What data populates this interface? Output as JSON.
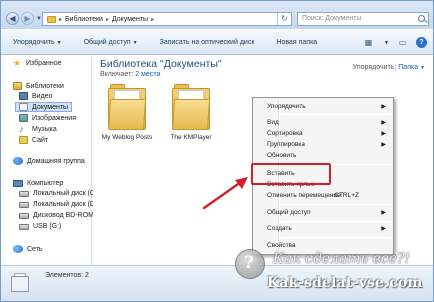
{
  "address": {
    "crumbs": [
      "Библиотеки",
      "Документы"
    ],
    "search_placeholder": "Поиск: Документы"
  },
  "toolbar": {
    "organize": "Упорядочить",
    "share": "Общий доступ",
    "burn": "Записать на оптический диск",
    "new_folder": "Новая папка"
  },
  "sidebar": {
    "favorites": "Избранное",
    "libraries": "Библиотеки",
    "video": "Видео",
    "documents": "Документы",
    "images": "Изображения",
    "music": "Музыка",
    "site": "Сайт",
    "homegroup": "Домашняя группа",
    "computer": "Компьютер",
    "disk_c": "Локальный диск (C",
    "disk_d": "Локальный диск (D",
    "bd_rom": "Дисковод BD-ROM",
    "usb": "USB (G:)",
    "network": "Сеть"
  },
  "content": {
    "title": "Библиотека \"Документы\"",
    "subtitle_prefix": "Включает:",
    "subtitle_link": "2 места",
    "arrange_label": "Упорядочить:",
    "arrange_value": "Папка",
    "folders": [
      "My Weblog Posts",
      "The KMPlayer"
    ]
  },
  "context_menu": {
    "items": [
      "Упорядочить",
      "Вид",
      "Сортировка",
      "Группировка",
      "Обновить",
      "Вставить",
      "Вставить ярлык",
      "Отменить перемещение",
      "Общий доступ",
      "Создать",
      "Свойства"
    ],
    "undo_shortcut": "CTRL+Z",
    "highlighted_item": "Вставить"
  },
  "status": {
    "items_count": "Элементов: 2"
  },
  "watermark": {
    "script_text": "Как сделать все?!",
    "url": "Kak-sdelat-vse.com"
  },
  "colors": {
    "highlight_box": "#d1202a",
    "arrow": "#d1202a",
    "link": "#1a5cb0",
    "title": "#1f4d8a"
  }
}
